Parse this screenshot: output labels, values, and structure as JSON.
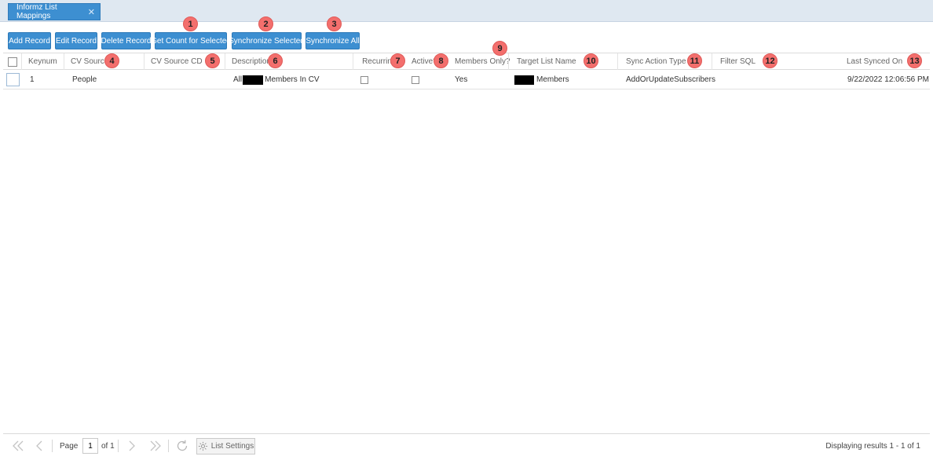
{
  "tab": {
    "title": "Informz List Mappings",
    "close": "✕"
  },
  "toolbar": {
    "add": "Add Record",
    "edit": "Edit Record",
    "delete": "Delete Record",
    "get_count": "Get Count for Selected",
    "sync_selected": "Synchronize Selected",
    "sync_all": "Synchronize All"
  },
  "columns": {
    "keynum": "Keynum",
    "cv_source": "CV Source",
    "cv_source_cd": "CV Source CD",
    "description": "Description",
    "recurring": "Recurring?",
    "active": "Active?",
    "members_only": "Members Only?",
    "target_list_name": "Target List Name",
    "sync_action_type": "Sync Action Type",
    "filter_sql": "Filter SQL",
    "last_synced_on": "Last Synced On"
  },
  "rows": [
    {
      "keynum": "1",
      "cv_source": "People",
      "cv_source_cd": "",
      "description_prefix": "All",
      "description_suffix": "Members In CV",
      "recurring": false,
      "active": false,
      "members_only": "Yes",
      "target_list_suffix": "Members",
      "sync_action_type": "AddOrUpdateSubscribers",
      "filter_sql": "",
      "last_synced_on": "9/22/2022 12:06:56 PM"
    }
  ],
  "badges": [
    "1",
    "2",
    "3",
    "4",
    "5",
    "6",
    "7",
    "8",
    "9",
    "10",
    "11",
    "12",
    "13"
  ],
  "pager": {
    "page_label": "Page",
    "page_value": "1",
    "of_label": "of 1",
    "list_settings": "List Settings",
    "results": "Displaying results 1 - 1 of 1"
  },
  "colors": {
    "button_bg": "#3d8fd1",
    "badge_bg": "#f36f6d",
    "topbar_bg": "#dfe8f1"
  }
}
